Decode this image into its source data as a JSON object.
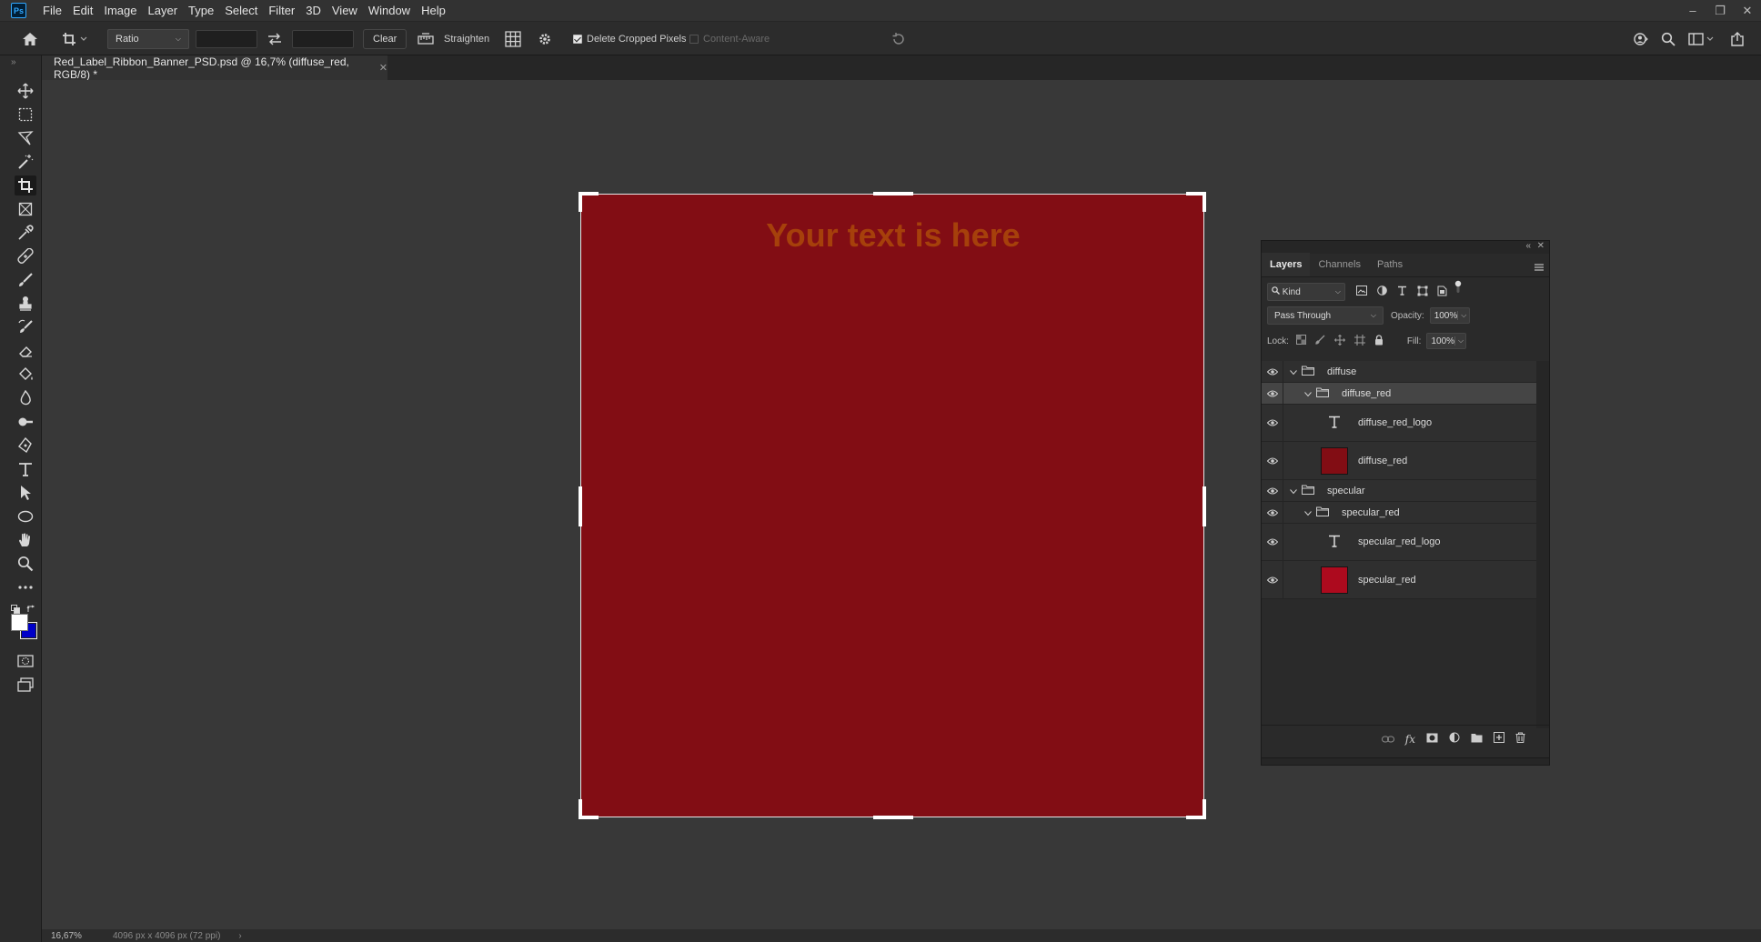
{
  "menubar": {
    "app_icon": "Ps",
    "items": [
      "File",
      "Edit",
      "Image",
      "Layer",
      "Type",
      "Select",
      "Filter",
      "3D",
      "View",
      "Window",
      "Help"
    ]
  },
  "options": {
    "ratio_label": "Ratio",
    "clear_label": "Clear",
    "straighten_label": "Straighten",
    "delete_cropped_label": "Delete Cropped Pixels",
    "delete_cropped_checked": true,
    "content_aware_label": "Content-Aware",
    "content_aware_checked": false
  },
  "document": {
    "tab_title": "Red_Label_Ribbon_Banner_PSD.psd @ 16,7% (diffuse_red, RGB/8) *",
    "canvas_text": "Your text is here",
    "canvas_color": "#820d14",
    "text_color": "#a6400b"
  },
  "status": {
    "zoom": "16,67%",
    "doc_info": "4096 px x 4096 px (72 ppi)"
  },
  "colors": {
    "foreground": "#ffffff",
    "background": "#0000c8"
  },
  "layers_panel": {
    "tabs": [
      "Layers",
      "Channels",
      "Paths"
    ],
    "active_tab": "Layers",
    "kind_label": "Kind",
    "blend_mode": "Pass Through",
    "opacity_label": "Opacity:",
    "opacity_value": "100%",
    "lock_label": "Lock:",
    "fill_label": "Fill:",
    "fill_value": "100%",
    "layers": [
      {
        "name": "diffuse",
        "type": "group",
        "indent": 0
      },
      {
        "name": "diffuse_red",
        "type": "group",
        "indent": 1,
        "selected": true
      },
      {
        "name": "diffuse_red_logo",
        "type": "text",
        "indent": 2
      },
      {
        "name": "diffuse_red",
        "type": "pixel",
        "indent": 2,
        "thumb_color": "#820d14"
      },
      {
        "name": "specular",
        "type": "group",
        "indent": 0
      },
      {
        "name": "specular_red",
        "type": "group",
        "indent": 1
      },
      {
        "name": "specular_red_logo",
        "type": "text",
        "indent": 2
      },
      {
        "name": "specular_red",
        "type": "pixel",
        "indent": 2,
        "thumb_color": "#ad0a1e"
      }
    ]
  }
}
